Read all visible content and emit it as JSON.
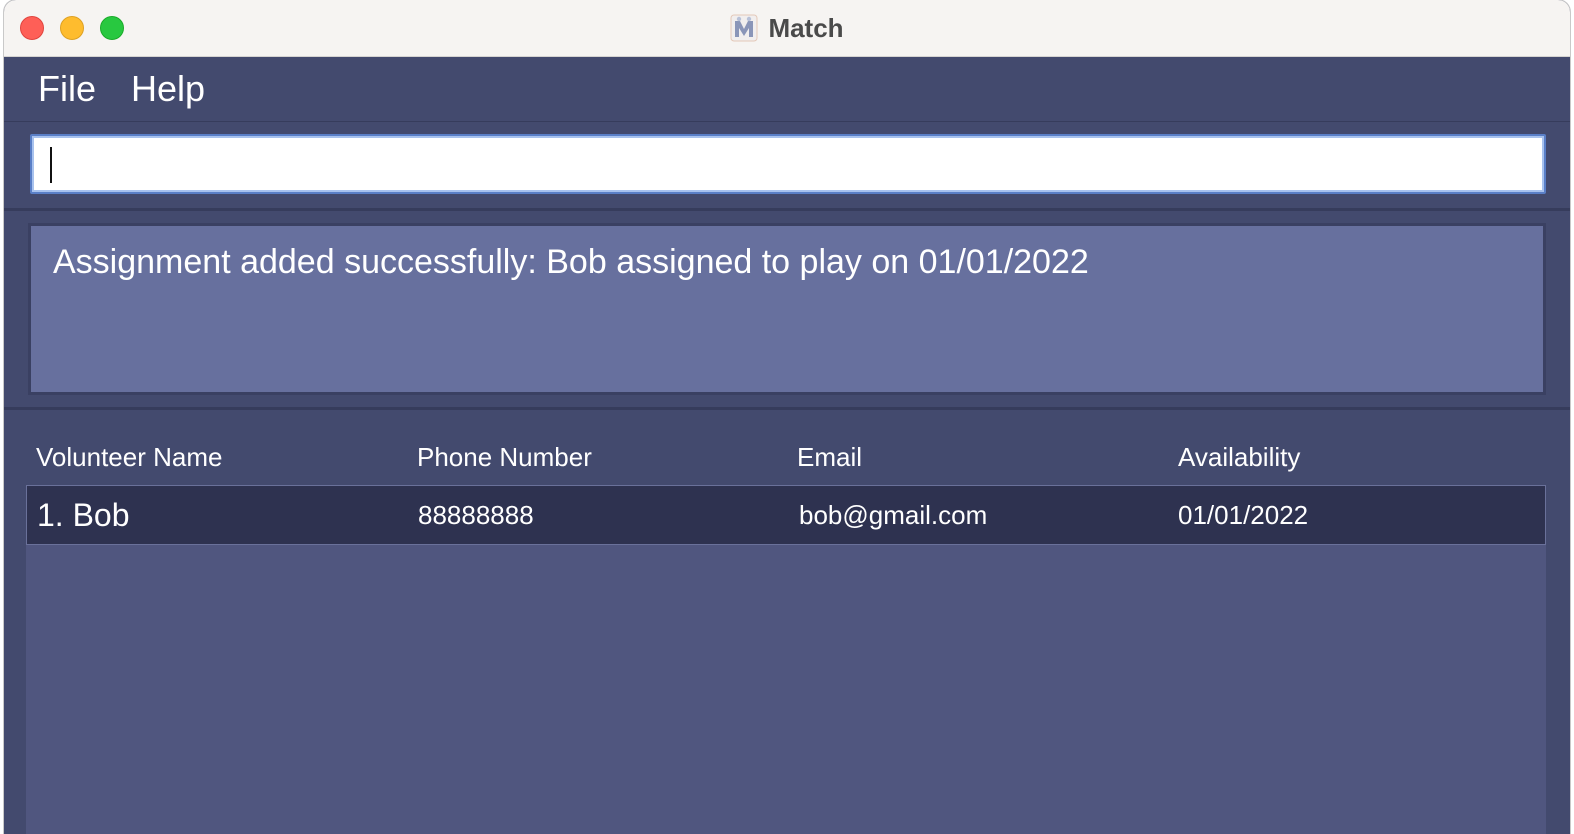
{
  "window": {
    "title": "Match",
    "app_icon": "match-logo-icon",
    "controls": [
      "close",
      "minimize",
      "maximize"
    ]
  },
  "menu": {
    "file_label": "File",
    "help_label": "Help"
  },
  "command": {
    "value": "",
    "placeholder": ""
  },
  "result": {
    "message": "Assignment added successfully: Bob assigned to play on 01/01/2022"
  },
  "table": {
    "headers": [
      "Volunteer Name",
      "Phone Number",
      "Email",
      "Availability"
    ],
    "rows": [
      {
        "name": "1. Bob",
        "phone": "88888888",
        "email": "bob@gmail.com",
        "availability": "01/01/2022"
      }
    ]
  },
  "colors": {
    "background": "#3b4163",
    "panel": "#434a6e",
    "result_box": "#67709e",
    "list_panel": "#50567f",
    "selected_row": "#2e3250",
    "text": "#ffffff"
  }
}
